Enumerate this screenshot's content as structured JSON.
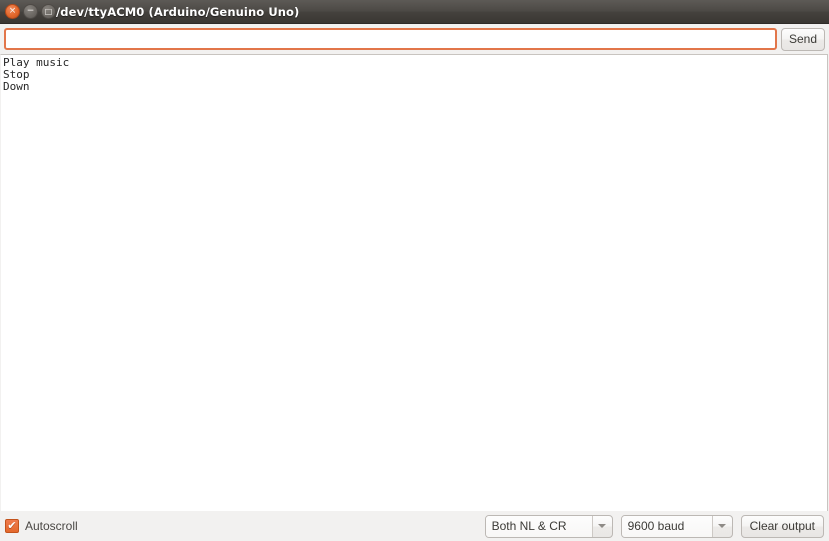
{
  "window": {
    "title": "/dev/ttyACM0 (Arduino/Genuino Uno)",
    "controls": {
      "close_label": "×",
      "minimize_label": "−",
      "maximize_label": "□"
    }
  },
  "send_row": {
    "input_value": "",
    "input_placeholder": "",
    "send_label": "Send"
  },
  "output": {
    "lines": [
      "Play music",
      "Stop",
      "Down"
    ],
    "text": "Play music\nStop\nDown"
  },
  "status_bar": {
    "autoscroll_label": "Autoscroll",
    "autoscroll_checked": true,
    "autoscroll_tick": "✔",
    "line_ending_value": "Both NL & CR",
    "baud_value": "9600 baud",
    "clear_output_label": "Clear output"
  },
  "colors": {
    "accent_orange": "#e4682c",
    "titlebar_dark": "#45423e",
    "chrome_gray": "#f2f1f0",
    "text_dark": "#262626"
  }
}
